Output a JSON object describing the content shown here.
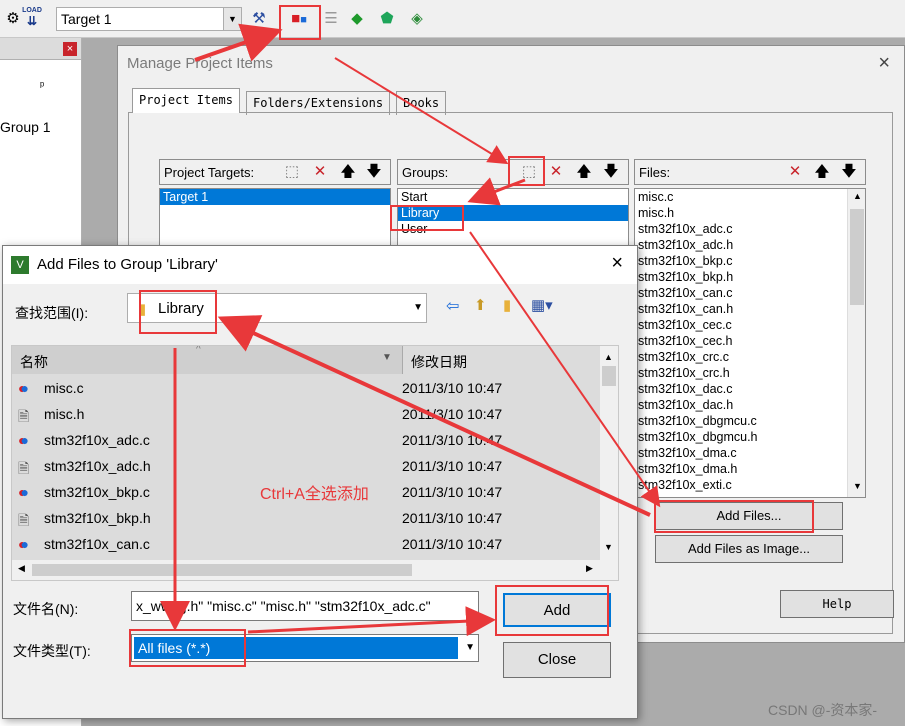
{
  "toolbar": {
    "target": "Target 1",
    "load_label": "LOAD"
  },
  "left_panel": {
    "group_label": "Group 1",
    "pin": "ᵖ",
    "close": "×"
  },
  "manage": {
    "title": "Manage Project Items",
    "tabs": [
      "Project Items",
      "Folders/Extensions",
      "Books"
    ],
    "targets_label": "Project Targets:",
    "groups_label": "Groups:",
    "files_label": "Files:",
    "targets": [
      "Target 1"
    ],
    "groups": [
      "Start",
      "Library",
      "User"
    ],
    "files": [
      "misc.c",
      "misc.h",
      "stm32f10x_adc.c",
      "stm32f10x_adc.h",
      "stm32f10x_bkp.c",
      "stm32f10x_bkp.h",
      "stm32f10x_can.c",
      "stm32f10x_can.h",
      "stm32f10x_cec.c",
      "stm32f10x_cec.h",
      "stm32f10x_crc.c",
      "stm32f10x_crc.h",
      "stm32f10x_dac.c",
      "stm32f10x_dac.h",
      "stm32f10x_dbgmcu.c",
      "stm32f10x_dbgmcu.h",
      "stm32f10x_dma.c",
      "stm32f10x_dma.h",
      "stm32f10x_exti.c"
    ],
    "add_files": "Add Files...",
    "add_files_image": "Add Files as Image...",
    "help": "Help"
  },
  "addfiles": {
    "title": "Add Files to Group 'Library'",
    "lookin_label": "查找范围(I):",
    "lookin_value": "Library",
    "col_name": "名称",
    "col_date": "修改日期",
    "files": [
      {
        "name": "misc.c",
        "date": "2011/3/10 10:47",
        "type": "c"
      },
      {
        "name": "misc.h",
        "date": "2011/3/10 10:47",
        "type": "h"
      },
      {
        "name": "stm32f10x_adc.c",
        "date": "2011/3/10 10:47",
        "type": "c"
      },
      {
        "name": "stm32f10x_adc.h",
        "date": "2011/3/10 10:47",
        "type": "h"
      },
      {
        "name": "stm32f10x_bkp.c",
        "date": "2011/3/10 10:47",
        "type": "c"
      },
      {
        "name": "stm32f10x_bkp.h",
        "date": "2011/3/10 10:47",
        "type": "h"
      },
      {
        "name": "stm32f10x_can.c",
        "date": "2011/3/10 10:47",
        "type": "c"
      }
    ],
    "filename_label": "文件名(N):",
    "filename_value": "x_wwdg.h\" \"misc.c\" \"misc.h\" \"stm32f10x_adc.c\"",
    "filetype_label": "文件类型(T):",
    "filetype_value": "All files (*.*)",
    "add_btn": "Add",
    "close_btn": "Close"
  },
  "annotation": "Ctrl+A全选添加",
  "watermark": "CSDN @-资本家-",
  "colors": {
    "accent": "#0078d7",
    "annotation": "#e8383a"
  }
}
